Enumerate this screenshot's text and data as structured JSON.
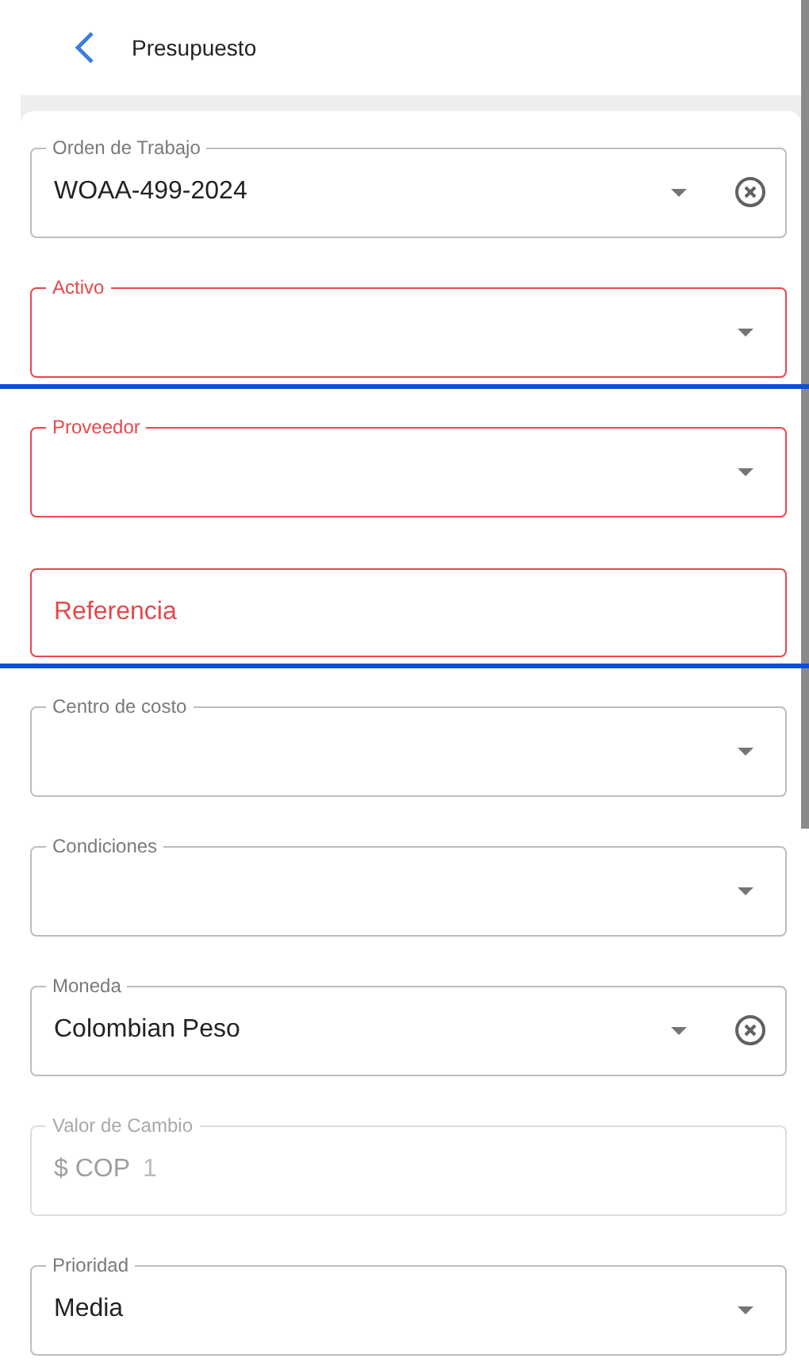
{
  "header": {
    "title": "Presupuesto"
  },
  "fields": [
    {
      "kind": "select",
      "label": "Orden de Trabajo",
      "value": "WOAA-499-2024",
      "error": false,
      "disabled": false,
      "clearable": true,
      "highlighted": false
    },
    {
      "kind": "select",
      "label": "Activo",
      "error": true,
      "disabled": false,
      "clearable": false,
      "highlighted": true
    },
    {
      "kind": "select",
      "label": "Proveedor",
      "error": true,
      "disabled": false,
      "clearable": false,
      "highlighted": false
    },
    {
      "kind": "text",
      "placeholder": "Referencia",
      "error": true,
      "disabled": false,
      "clearable": false,
      "highlighted": true
    },
    {
      "kind": "select",
      "label": "Centro de costo",
      "error": false,
      "disabled": false,
      "clearable": false,
      "highlighted": false
    },
    {
      "kind": "select",
      "label": "Condiciones",
      "error": false,
      "disabled": false,
      "clearable": false,
      "highlighted": false
    },
    {
      "kind": "select",
      "label": "Moneda",
      "value": "Colombian Peso",
      "error": false,
      "disabled": false,
      "clearable": true,
      "highlighted": false
    },
    {
      "kind": "text",
      "label": "Valor de Cambio",
      "prefix": "$ COP",
      "value": "1",
      "error": false,
      "disabled": true,
      "clearable": false,
      "highlighted": false
    },
    {
      "kind": "select",
      "label": "Prioridad",
      "value": "Media",
      "error": false,
      "disabled": false,
      "clearable": false,
      "highlighted": false
    }
  ]
}
